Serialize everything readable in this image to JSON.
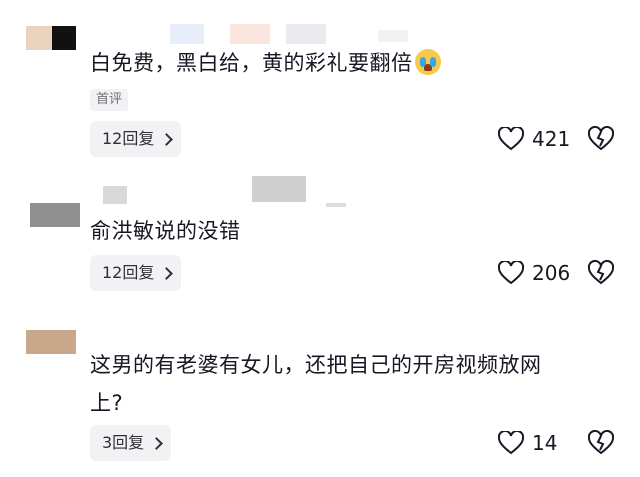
{
  "comments": [
    {
      "text": "白免费，黑白给，黄的彩礼要翻倍",
      "emoji": "crying-face-icon",
      "tag": "首评",
      "replies": "12回复",
      "likes": "421"
    },
    {
      "text": "俞洪敏说的没错",
      "replies": "12回复",
      "likes": "206"
    },
    {
      "text_line1": "这男的有老婆有女儿，还把自己的开房视频放网",
      "text_line2": "上?",
      "replies": "3回复",
      "likes": "14"
    }
  ],
  "colors": {
    "tag_bg": "#f2f2f4",
    "text": "#161823",
    "muted": "#6f6f78"
  }
}
